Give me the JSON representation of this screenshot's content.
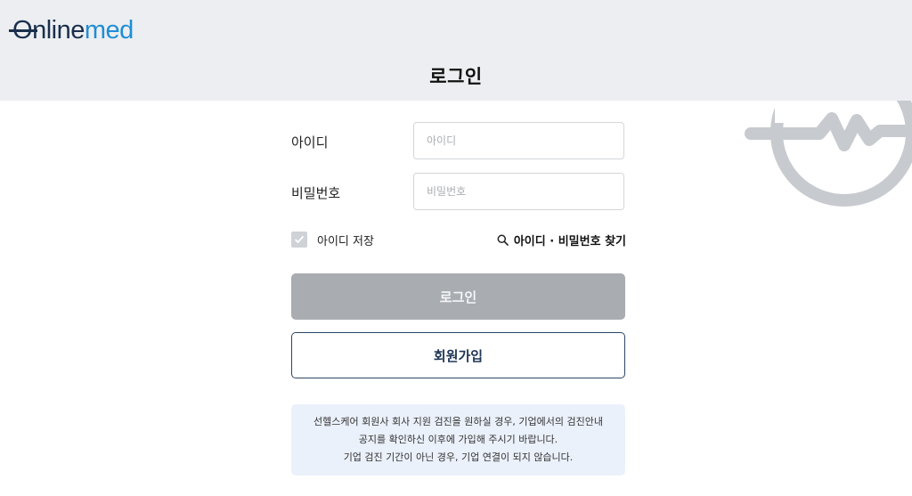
{
  "header": {
    "logo": {
      "part1": "O",
      "part2": "nline",
      "part3": "med"
    },
    "title": "로그인"
  },
  "form": {
    "id_label": "아이디",
    "id_placeholder": "아이디",
    "id_value": "",
    "pw_label": "비밀번호",
    "pw_placeholder": "비밀번호",
    "pw_value": "",
    "remember_label": "아이디 저장",
    "remember_checked": true,
    "find_link": "아이디 · 비밀번호 찾기",
    "login_button": "로그인",
    "signup_button": "회원가입"
  },
  "notice": {
    "line1": "선헬스케어 회원사 회사 지원 검진을 원하실 경우, 기업에서의 검진안내",
    "line2": "공지를 확인하신 이후에 가입해 주시기 바랍니다.",
    "line3": "기업 검진 기간이 아닌 경우, 기업 연결이 되지 않습니다."
  },
  "colors": {
    "header_bg": "#eceef1",
    "brand_dark": "#1a2f4e",
    "brand_blue": "#1f8ed6",
    "login_button_bg": "#a9acb1",
    "notice_bg": "#ebf1fb"
  },
  "icons": {
    "decor": "heartbeat-logo-icon",
    "find": "search-icon",
    "checkbox": "check-icon"
  }
}
